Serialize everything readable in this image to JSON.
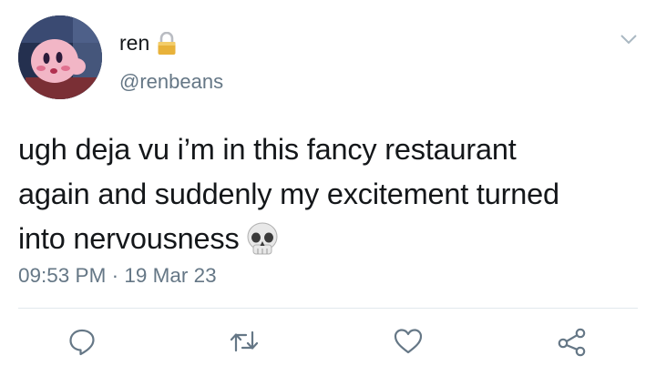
{
  "tweet": {
    "author": {
      "display_name": "ren",
      "handle": "@renbeans",
      "protected": true
    },
    "lines": [
      "ugh deja vu i’m in this fancy restaurant",
      "again and suddenly my excitement turned",
      "into nervousness"
    ],
    "emoji": "skull-emoji",
    "time": "09:53 PM",
    "separator": "·",
    "date": "19 Mar 23"
  },
  "icons": {
    "lock": "lock-icon",
    "caret": "chevron-down-icon",
    "reply": "reply-icon",
    "retweet": "retweet-icon",
    "like": "heart-icon",
    "share": "share-icon"
  },
  "colors": {
    "text": "#14171a",
    "secondary": "#657786",
    "divider": "#e1e8ed",
    "action_icon": "#657786",
    "lock_gold": "#d9a520"
  }
}
